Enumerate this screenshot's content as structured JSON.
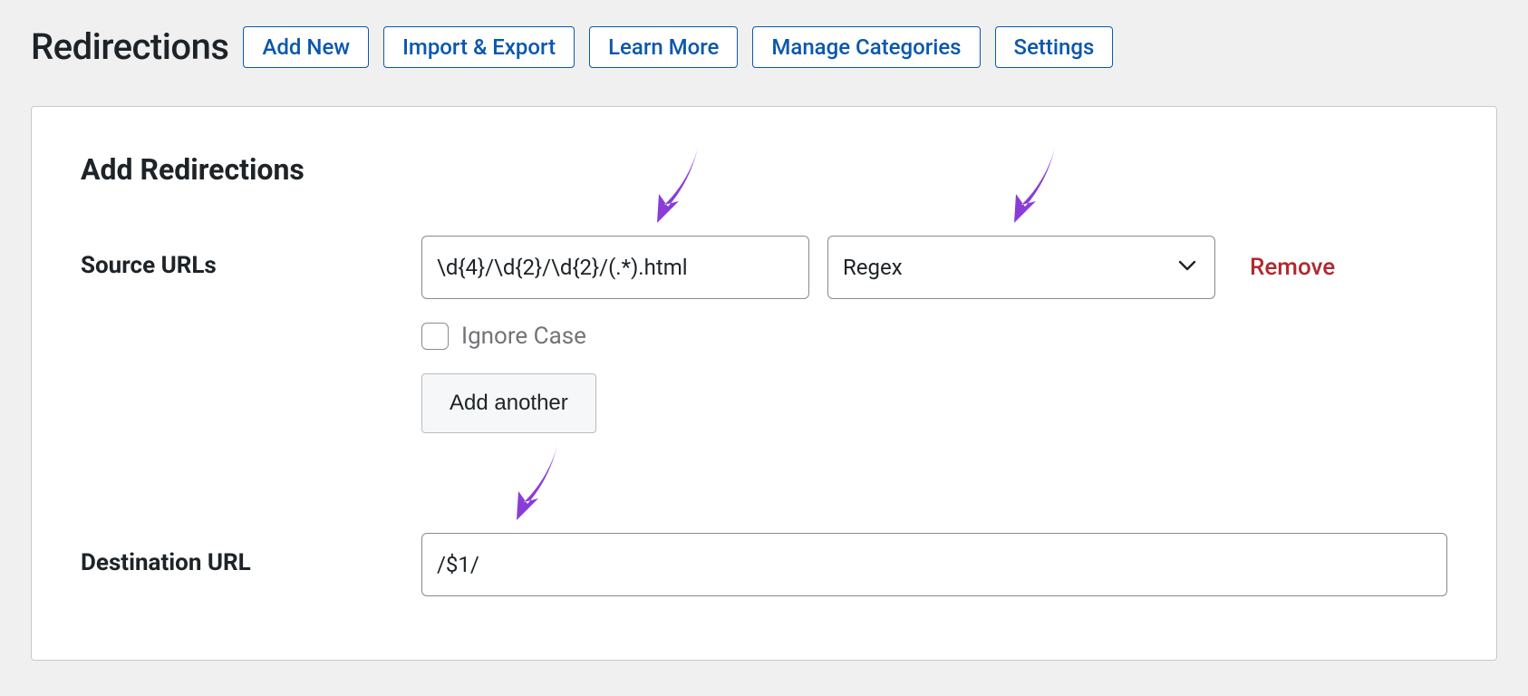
{
  "header": {
    "title": "Redirections",
    "buttons": {
      "add_new": "Add New",
      "import_export": "Import & Export",
      "learn_more": "Learn More",
      "manage_categories": "Manage Categories",
      "settings": "Settings"
    }
  },
  "card": {
    "heading": "Add Redirections",
    "source_label": "Source URLs",
    "destination_label": "Destination URL",
    "source_value": "\\d{4}/\\d{2}/\\d{2}/(.*).html",
    "match_type": "Regex",
    "ignore_case_label": "Ignore Case",
    "add_another_label": "Add another",
    "remove_label": "Remove",
    "destination_value": "/$1/"
  }
}
